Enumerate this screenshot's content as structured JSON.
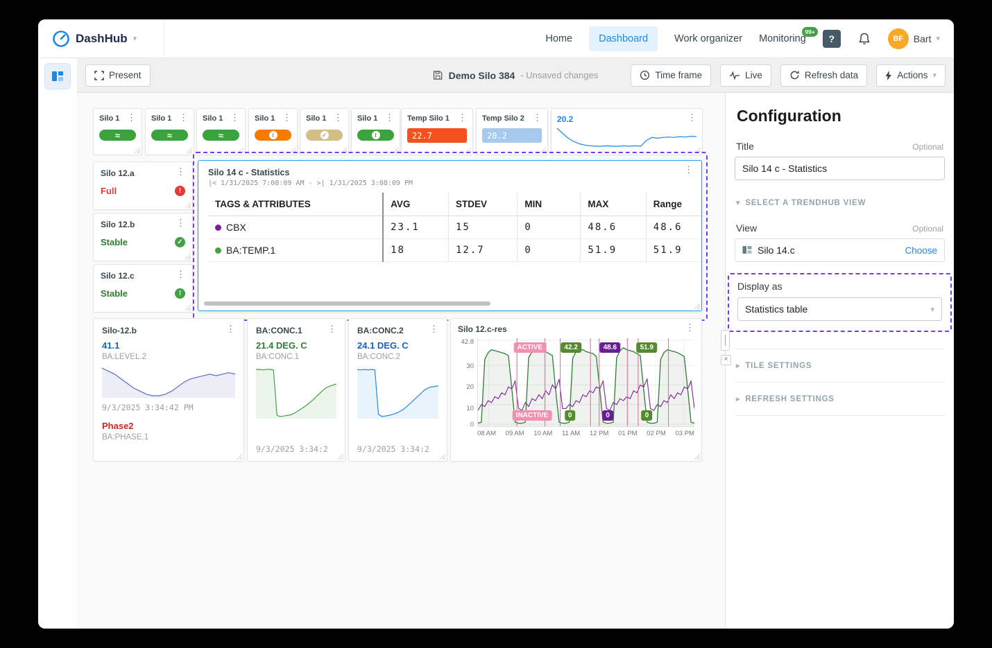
{
  "palette": {
    "accent_blue": "#1e88e5",
    "selection_purple": "#7c3aed",
    "green": "#43a047",
    "red": "#e53935",
    "orange": "#f4511e",
    "tan": "#d2bf85",
    "avatar_amber": "#f9a825",
    "pink": "#f06292",
    "series_purple": "#7b1fa2"
  },
  "icons": {
    "kebab": "⋮",
    "wave": "≈",
    "check": "✓",
    "info": "i",
    "exclaim": "!",
    "chevron_down": "▾",
    "chevron_right": "▸",
    "close": "×"
  },
  "navbar": {
    "brand": "DashHub",
    "links": [
      {
        "label": "Home"
      },
      {
        "label": "Dashboard"
      },
      {
        "label": "Work organizer"
      },
      {
        "label": "Monitoring"
      }
    ],
    "monitoring_badge": "99+",
    "help_label": "?",
    "avatar_initials": "BF",
    "user_name": "Bart"
  },
  "toolbar": {
    "present_label": "Present",
    "doc_title": "Demo Silo 384",
    "doc_status": "- Unsaved changes",
    "time_frame_label": "Time frame",
    "live_label": "Live",
    "refresh_label": "Refresh data",
    "actions_label": "Actions"
  },
  "tiles": {
    "small": [
      {
        "title": "Silo 1",
        "indicator": "wave",
        "color": "#3ba33b"
      },
      {
        "title": "Silo 1",
        "indicator": "wave",
        "color": "#3ba33b"
      },
      {
        "title": "Silo 1",
        "indicator": "wave",
        "color": "#3ba33b"
      },
      {
        "title": "Silo 1",
        "indicator": "info",
        "color": "#f57c00"
      },
      {
        "title": "Silo 1",
        "indicator": "check",
        "color": "#d2bf85"
      },
      {
        "title": "Silo 1",
        "indicator": "info",
        "color": "#3ba33b"
      }
    ],
    "temp": [
      {
        "title": "Temp Silo 1",
        "value": "22.7",
        "color": "#f4511e"
      },
      {
        "title": "Temp Silo 2",
        "value": "20.2",
        "color": "#a6c9ee"
      }
    ],
    "spark": {
      "value": "20.2",
      "points": [
        75,
        62,
        50,
        42,
        36,
        33,
        31,
        30,
        30,
        31,
        30,
        30,
        31,
        30,
        31,
        30,
        44,
        52,
        50,
        52,
        53,
        52,
        54,
        53,
        55,
        54
      ]
    },
    "status": [
      {
        "title": "Silo 12.a",
        "state": "Full",
        "badge": "exclaim",
        "badge_color": "#e53935"
      },
      {
        "title": "Silo 12.b",
        "state": "Stable",
        "badge": "check",
        "badge_color": "#43a047"
      },
      {
        "title": "Silo 12.c",
        "state": "Stable",
        "badge": "exclaim",
        "badge_color": "#43a047"
      }
    ],
    "stats": {
      "title": "Silo 14 c - Statistics",
      "time_range": "|< 1/31/2025 7:08:09 AM  - >| 1/31/2025 3:08:09 PM",
      "columns": [
        "TAGS & ATTRIBUTES",
        "AVG",
        "STDEV",
        "MIN",
        "MAX",
        "Range"
      ],
      "rows": [
        {
          "tag": "CBX",
          "color": "#7b1fa2",
          "avg": "23.1",
          "stdev": "15",
          "min": "0",
          "max": "48.6",
          "range": "48.6"
        },
        {
          "tag": "BA:TEMP.1",
          "color": "#43a047",
          "avg": "18",
          "stdev": "12.7",
          "min": "0",
          "max": "51.9",
          "range": "51.9"
        }
      ]
    },
    "detail": [
      {
        "title": "Silo-12.b",
        "value": "41.1",
        "tag": "BA:LEVEL.2",
        "timestamp": "9/3/2025 3:34:42 PM",
        "value2": "Phase2",
        "tag2": "BA:PHASE.1",
        "points": [
          58,
          56,
          54,
          51,
          48,
          45,
          43,
          41,
          40,
          40,
          41,
          43,
          46,
          49,
          51,
          52,
          53,
          54,
          53,
          54,
          55,
          54
        ]
      },
      {
        "title": "BA:CONC.1",
        "value": "21.4 DEG. C",
        "tag": "BA:CONC.1",
        "timestamp": "9/3/2025 3:34:2",
        "points": [
          88,
          88,
          87,
          88,
          88,
          87,
          6,
          4,
          5,
          6,
          7,
          10,
          14,
          18,
          22,
          27,
          32,
          38,
          44,
          50,
          55,
          58,
          60,
          62
        ]
      },
      {
        "title": "BA:CONC.2",
        "value": "24.1 DEG. C",
        "tag": "BA:CONC.2",
        "timestamp": "9/3/2025 3:34:2",
        "points": [
          90,
          89,
          90,
          89,
          90,
          89,
          8,
          4,
          5,
          6,
          8,
          10,
          13,
          17,
          22,
          28,
          34,
          40,
          46,
          52,
          56,
          58,
          59,
          60
        ]
      }
    ],
    "res": {
      "title": "Silo 12.c-res",
      "ymax": 42.8,
      "y_ticks": [
        "42.8",
        "30",
        "20",
        "10",
        "0"
      ],
      "y_values": [
        42.8,
        30,
        20,
        10,
        0
      ],
      "x_ticks": [
        "08 AM",
        "09 AM",
        "10 AM",
        "11 AM",
        "12 PM",
        "01 PM",
        "02 PM",
        "03 PM"
      ],
      "badges_top": [
        {
          "label": "ACTIVE",
          "type": "pink"
        },
        {
          "label": "42.2",
          "type": "green"
        },
        {
          "label": "48.6",
          "type": "purple"
        },
        {
          "label": "51.9",
          "type": "green"
        }
      ],
      "badges_bottom": [
        {
          "label": "INACTIVE",
          "type": "pink"
        },
        {
          "label": "0",
          "type": "green"
        },
        {
          "label": "0",
          "type": "purple"
        },
        {
          "label": "0",
          "type": "green"
        }
      ],
      "pink_lines": [
        0.18,
        0.31,
        0.38,
        0.52,
        0.56,
        0.69,
        0.74,
        0.88
      ],
      "green_series": [
        0.5,
        1,
        33,
        36.5,
        38,
        37.5,
        37,
        36.5,
        36,
        35,
        18,
        1,
        0.5,
        0.5,
        1,
        34,
        37,
        38.5,
        38,
        37.5,
        37,
        36,
        35,
        17,
        1,
        0.5,
        0.5,
        1,
        33.5,
        37,
        38,
        38,
        37,
        36.5,
        36,
        34.5,
        18,
        1,
        0.5,
        0.5,
        1,
        34,
        37.5,
        39,
        38,
        37.5,
        37,
        36,
        35,
        17.5,
        1,
        0.5,
        0.5,
        1,
        33,
        36.5,
        38,
        37.5,
        37,
        36.5,
        35.5,
        34.5,
        18,
        1,
        0.5
      ],
      "purple_series": [
        7,
        10,
        9,
        12,
        11,
        14,
        13,
        16,
        15,
        19,
        18,
        22,
        8,
        7,
        11,
        9,
        13,
        12,
        15,
        13,
        17,
        15,
        20,
        18,
        23,
        8,
        8,
        10,
        9,
        12,
        11,
        15,
        14,
        17,
        16,
        19,
        18,
        22,
        8,
        7,
        11,
        10,
        13,
        12,
        14,
        13,
        17,
        16,
        20,
        19,
        23,
        8,
        7,
        10,
        9,
        12,
        11,
        15,
        13,
        16,
        15,
        19,
        18,
        22,
        8
      ]
    }
  },
  "config": {
    "heading": "Configuration",
    "title_label": "Title",
    "optional": "Optional",
    "title_value": "Silo 14 c - Statistics",
    "trendhub_section": "SELECT A TRENDHUB VIEW",
    "view_label": "View",
    "view_value": "Silo 14.c",
    "choose_label": "Choose",
    "display_as_label": "Display as",
    "display_as_value": "Statistics table",
    "tile_settings": "TILE SETTINGS",
    "refresh_settings": "REFRESH SETTINGS"
  }
}
